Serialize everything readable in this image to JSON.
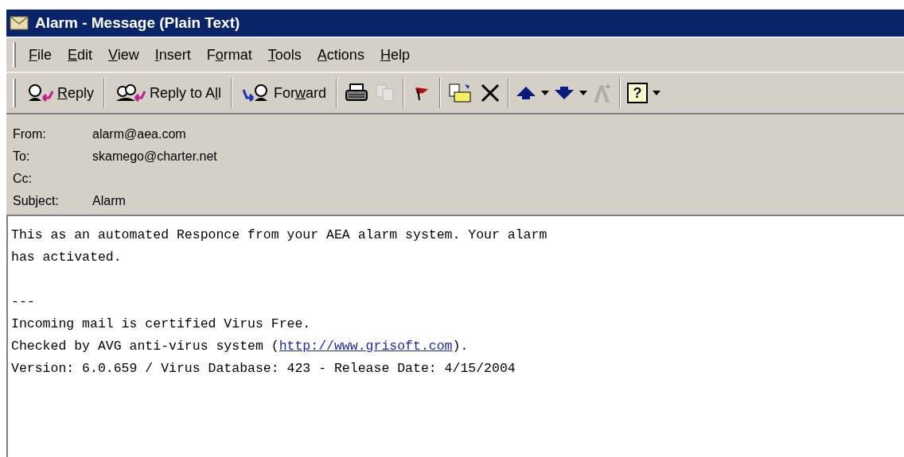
{
  "window": {
    "title": "Alarm - Message (Plain Text)"
  },
  "menu": [
    {
      "label": "File"
    },
    {
      "label": "Edit"
    },
    {
      "label": "View"
    },
    {
      "label": "Insert"
    },
    {
      "label": "Format"
    },
    {
      "label": "Tools"
    },
    {
      "label": "Actions"
    },
    {
      "label": "Help"
    }
  ],
  "toolbar": [
    {
      "kind": "reply",
      "label": "Reply"
    },
    {
      "kind": "reply_all",
      "label": "Reply to All"
    },
    {
      "kind": "forward",
      "label": "Forward"
    },
    {
      "kind": "print"
    },
    {
      "kind": "copy",
      "disabled": true
    },
    {
      "kind": "sep"
    },
    {
      "kind": "flag"
    },
    {
      "kind": "sep"
    },
    {
      "kind": "move"
    },
    {
      "kind": "delete"
    },
    {
      "kind": "sep"
    },
    {
      "kind": "up"
    },
    {
      "kind": "caret"
    },
    {
      "kind": "down"
    },
    {
      "kind": "caret"
    },
    {
      "kind": "font",
      "disabled": true
    },
    {
      "kind": "sep"
    },
    {
      "kind": "help",
      "glyph": "?"
    },
    {
      "kind": "caret"
    }
  ],
  "headers": [
    {
      "label": "From:",
      "value": "alarm@aea.com"
    },
    {
      "label": "To:",
      "value": "skamego@charter.net"
    },
    {
      "label": "Cc:"
    },
    {
      "label": "Subject:",
      "value": "Alarm"
    }
  ],
  "body": [
    {
      "text": "This as an automated Responce from your AEA alarm system. Your alarm"
    },
    {
      "text": "has activated."
    },
    {
      "kind": "blank"
    },
    {
      "text": "---"
    },
    {
      "text": "Incoming mail is certified Virus Free."
    },
    {
      "text": "Checked by AVG anti-virus system (",
      "link": "http://www.grisoft.com",
      "after": ")."
    },
    {
      "text": "Version: 6.0.659 / Virus Database: 423 - Release Date: 4/15/2004"
    }
  ]
}
